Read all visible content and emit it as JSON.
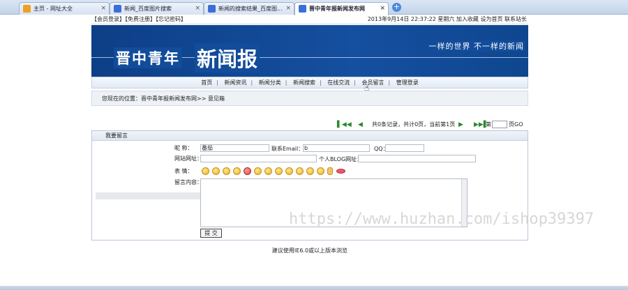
{
  "tabs": [
    {
      "label": "主页 - 网址大全",
      "icon_color": "#f0a020"
    },
    {
      "label": "新闻_百度图片搜索",
      "icon_color": "#3b6fd8"
    },
    {
      "label": "新闻的搜索结果_百度图...",
      "icon_color": "#3b6fd8"
    },
    {
      "label": "晋中青年报新闻发布网",
      "icon_color": "#3b6fd8",
      "active": true
    }
  ],
  "new_tab_symbol": "+",
  "topbar": {
    "left": "【会员登录】【免费注册】【忘记密码】",
    "right": "2013年9月14日 22:37:22  星期六   加入收藏  设为首页  联系站长"
  },
  "banner": {
    "title_part1": "晋中青年",
    "title_part2": "新闻报",
    "slogan": "一样的世界 不一样的新闻"
  },
  "nav": [
    "首页",
    "新闻资讯",
    "新闻分类",
    "新闻搜索",
    "在线交流",
    "会员留言",
    "管理登录"
  ],
  "breadcrumb": "您现在的位置：晋中青年报新闻发布网>> 意见箱",
  "pager": {
    "summary": "共0条记录，共计0页，当前第1页",
    "page_label_pre": "第",
    "page_label_post": "页GO"
  },
  "form": {
    "header": "我要留言",
    "nickname_label": "昵    称：",
    "nickname_value": "番茄",
    "email_label": "联系Email：",
    "email_value": "b",
    "qq_label": "QQ：",
    "site_label": "网站网址：",
    "blog_label": "个人BLOG网址：",
    "face_label": "表    情：",
    "content_label": "留言内容：",
    "submit_label": "提 交"
  },
  "footer": "建议使用IE6.0或以上版本浏览",
  "watermark": "https://www.huzhan.com/ishop39397",
  "colors": {
    "banner": "#124c9a",
    "accent": "#2a8a2a"
  }
}
